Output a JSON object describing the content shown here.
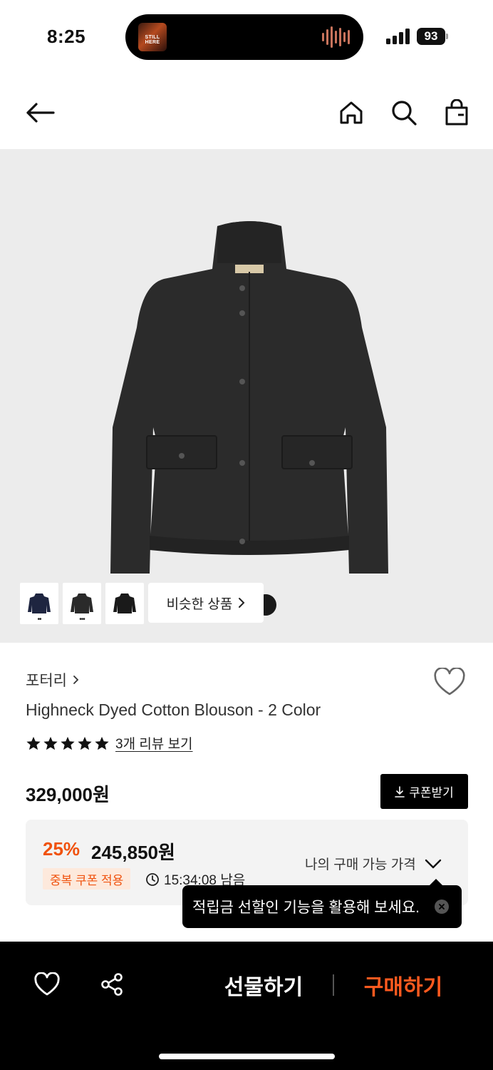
{
  "status_bar": {
    "time": "8:25",
    "now_playing_art_text": "STILL HERE",
    "battery": "93"
  },
  "nav": {
    "back_icon": "arrow-left-icon",
    "home_icon": "home-icon",
    "search_icon": "search-icon",
    "cart_icon": "shopping-bag-icon"
  },
  "gallery": {
    "thumbnails": [
      {
        "color": "#1e2540",
        "dots": "••"
      },
      {
        "color": "#2a2a2a",
        "dots": "•••"
      },
      {
        "color": "#1a1a1a",
        "dots": ""
      }
    ],
    "similar_label": "비슷한 상품"
  },
  "product": {
    "brand": "포터리",
    "name": "Highneck Dyed Cotton Blouson - 2 Color",
    "rating_stars": 5,
    "review_link": "3개 리뷰 보기",
    "original_price": "329,000원",
    "coupon_button": "쿠폰받기"
  },
  "price_box": {
    "discount": "25%",
    "sale_price": "245,850원",
    "coupon_badge": "중복 쿠폰 적용",
    "timer": "15:34:08 남음",
    "my_price_label": "나의 구매 가능 가격"
  },
  "tooltip": {
    "text": "적립금 선할인 기능을 활용해 보세요."
  },
  "bottom_bar": {
    "gift_label": "선물하기",
    "buy_label": "구매하기"
  },
  "colors": {
    "accent": "#f0520e",
    "buy": "#ff5a1f",
    "badge_bg": "#fde9dc"
  }
}
